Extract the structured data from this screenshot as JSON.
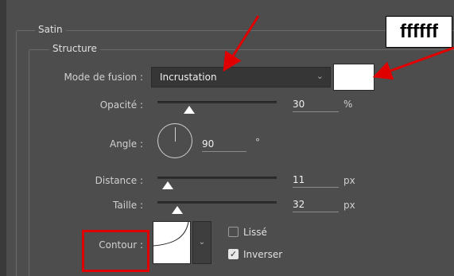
{
  "group_title": "Satin",
  "subgroup_title": "Structure",
  "blend_mode": {
    "label": "Mode de fusion :",
    "value": "Incrustation",
    "swatch_color": "#ffffff"
  },
  "opacity": {
    "label": "Opacité :",
    "value": "30",
    "unit": "%",
    "level": 30
  },
  "angle": {
    "label": "Angle :",
    "value": "90",
    "unit": "°"
  },
  "distance": {
    "label": "Distance :",
    "value": "11",
    "unit": "px"
  },
  "size": {
    "label": "Taille :",
    "value": "32",
    "unit": "px"
  },
  "contour": {
    "label": "Contour :",
    "smooth_label": "Lissé",
    "smooth_checked": false,
    "invert_label": "Inverser",
    "invert_checked": true
  },
  "annotation": {
    "text": "ffffff",
    "color": "#e00000"
  },
  "icons": {
    "dropdown": "chevron-down-icon",
    "checkbox_check": "check-icon"
  }
}
